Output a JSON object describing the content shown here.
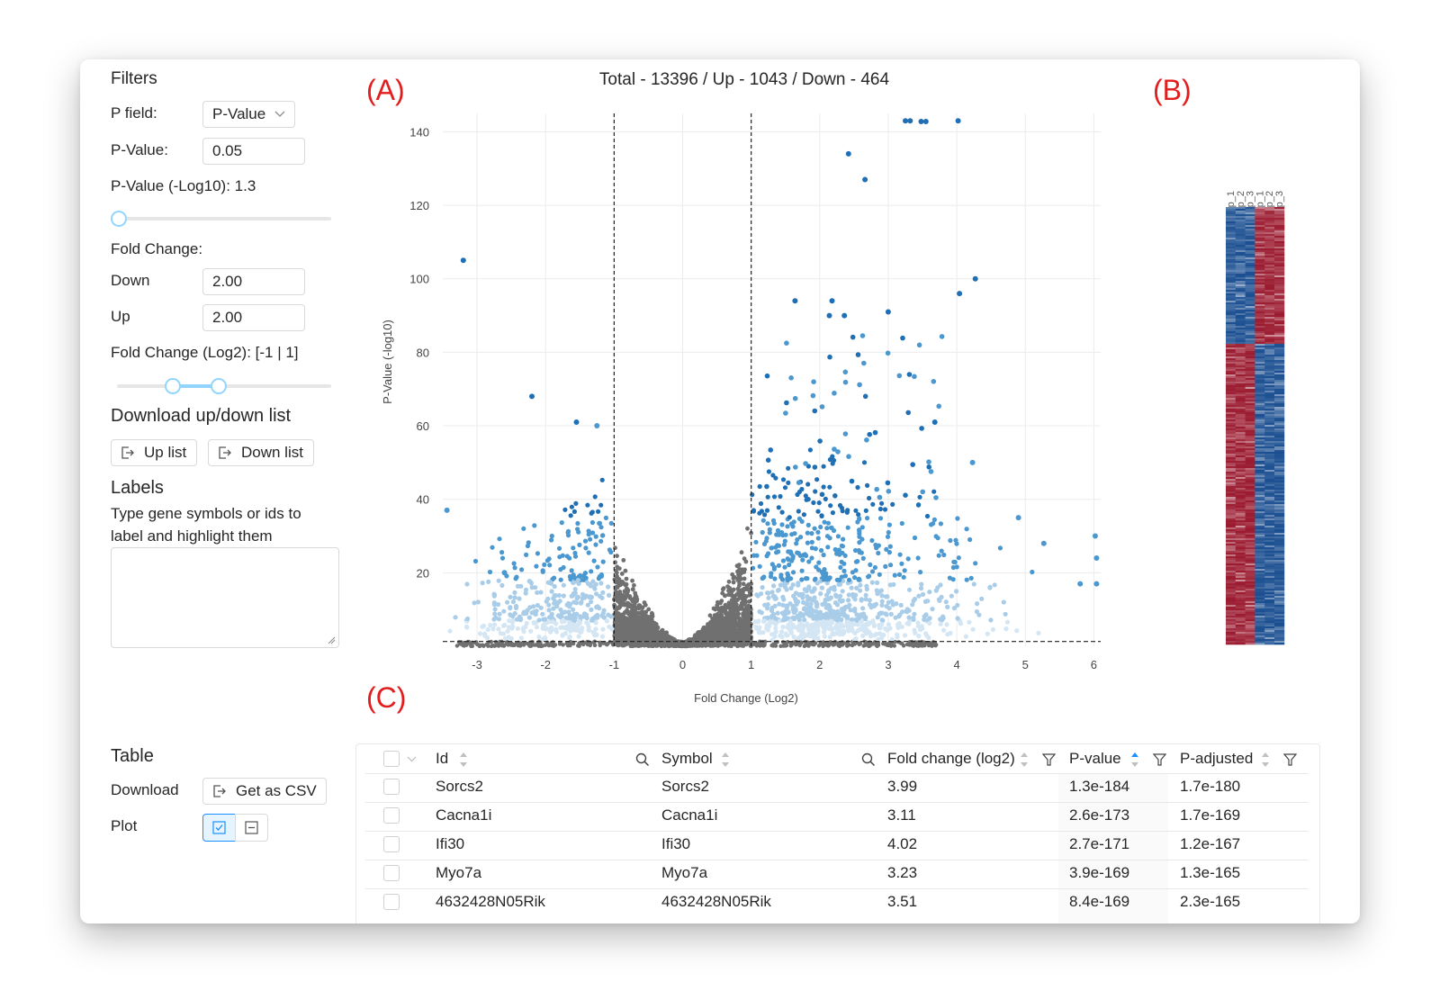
{
  "filters": {
    "title": "Filters",
    "p_field_label": "P field:",
    "p_field_value": "P-Value",
    "p_value_label": "P-Value:",
    "p_value": "0.05",
    "p_value_log_label": "P-Value (-Log10): 1.3",
    "p_slider_value": 0,
    "fold_change_label": "Fold Change:",
    "down_label": "Down",
    "down_value": "2.00",
    "up_label": "Up",
    "up_value": "2.00",
    "fold_change_log2_label": "Fold Change (Log2): [-1 | 1]"
  },
  "download": {
    "title": "Download up/down list",
    "up_list": "Up list",
    "down_list": "Down list"
  },
  "labels": {
    "title": "Labels",
    "description_line1": "Type gene symbols or ids to",
    "description_line2": "label and highlight them",
    "textarea_value": ""
  },
  "table_controls": {
    "title": "Table",
    "download_label": "Download",
    "csv_button": "Get as CSV",
    "plot_label": "Plot"
  },
  "panels": {
    "a": "(A)",
    "b": "(B)",
    "c": "(C)"
  },
  "chart_data": {
    "type": "scatter",
    "title": "Total - 13396 / Up - 1043 / Down - 464",
    "xlabel": "Fold Change (Log2)",
    "ylabel": "P-Value (-log10)",
    "xlim": [
      -3.5,
      6.1
    ],
    "ylim": [
      0,
      145
    ],
    "x_ticks": [
      -3,
      -2,
      -1,
      0,
      1,
      2,
      3,
      4,
      5,
      6
    ],
    "y_ticks": [
      20,
      40,
      60,
      80,
      100,
      120,
      140
    ],
    "grid": true,
    "thresholds": {
      "x": [
        -1,
        1
      ],
      "y": 1.3
    },
    "colors": {
      "ns": "#707070",
      "sig_dark": "#1f6fb4",
      "sig_mid": "#4a98cf",
      "sig_light": "#a9cde8",
      "sig_faint": "#d4e6f4",
      "threshold": "#222222"
    },
    "highlighted_points": [
      {
        "x": 3.25,
        "y": 143
      },
      {
        "x": 3.32,
        "y": 143
      },
      {
        "x": 3.48,
        "y": 142.8
      },
      {
        "x": 3.55,
        "y": 142.8
      },
      {
        "x": 4.02,
        "y": 143
      },
      {
        "x": 2.42,
        "y": 134
      },
      {
        "x": 2.66,
        "y": 127
      },
      {
        "x": -3.2,
        "y": 105
      },
      {
        "x": 4.27,
        "y": 100
      },
      {
        "x": 4.04,
        "y": 96
      },
      {
        "x": 1.64,
        "y": 94
      },
      {
        "x": 2.18,
        "y": 94
      },
      {
        "x": 3.0,
        "y": 91
      },
      {
        "x": 2.14,
        "y": 90
      },
      {
        "x": 2.36,
        "y": 90
      },
      {
        "x": -2.2,
        "y": 68
      },
      {
        "x": -1.55,
        "y": 61
      },
      {
        "x": -1.25,
        "y": 60
      },
      {
        "x": 3.68,
        "y": 61
      },
      {
        "x": 4.23,
        "y": 50
      },
      {
        "x": -3.44,
        "y": 37
      },
      {
        "x": 4.9,
        "y": 35
      },
      {
        "x": 5.27,
        "y": 28
      },
      {
        "x": 6.02,
        "y": 30
      },
      {
        "x": 6.04,
        "y": 24
      },
      {
        "x": 5.8,
        "y": 17
      },
      {
        "x": 6.04,
        "y": 17
      },
      {
        "x": -2.6,
        "y": 20
      }
    ]
  },
  "heatmap": {
    "column_labels": [
      "Dox_day_3__Rep_1",
      "Dox_day_3__Rep_2",
      "Dox_day_3__Rep_3",
      "Untreated__Rep_1",
      "Untreated__Rep_2",
      "Untreated__Rep_3"
    ],
    "upper_fraction": 0.31,
    "colors": {
      "high": "#9b1b30",
      "low": "#1b4f91"
    }
  },
  "table": {
    "columns": [
      "Id",
      "Symbol",
      "Fold change (log2)",
      "P-value",
      "P-adjusted"
    ],
    "sorted_column": "P-value",
    "rows": [
      {
        "id": "Sorcs2",
        "symbol": "Sorcs2",
        "fc": "3.99",
        "pvalue": "1.3e-184",
        "padj": "1.7e-180"
      },
      {
        "id": "Cacna1i",
        "symbol": "Cacna1i",
        "fc": "3.11",
        "pvalue": "2.6e-173",
        "padj": "1.7e-169"
      },
      {
        "id": "Ifi30",
        "symbol": "Ifi30",
        "fc": "4.02",
        "pvalue": "2.7e-171",
        "padj": "1.2e-167"
      },
      {
        "id": "Myo7a",
        "symbol": "Myo7a",
        "fc": "3.23",
        "pvalue": "3.9e-169",
        "padj": "1.3e-165"
      },
      {
        "id": "4632428N05Rik",
        "symbol": "4632428N05Rik",
        "fc": "3.51",
        "pvalue": "8.4e-169",
        "padj": "2.3e-165"
      }
    ]
  }
}
